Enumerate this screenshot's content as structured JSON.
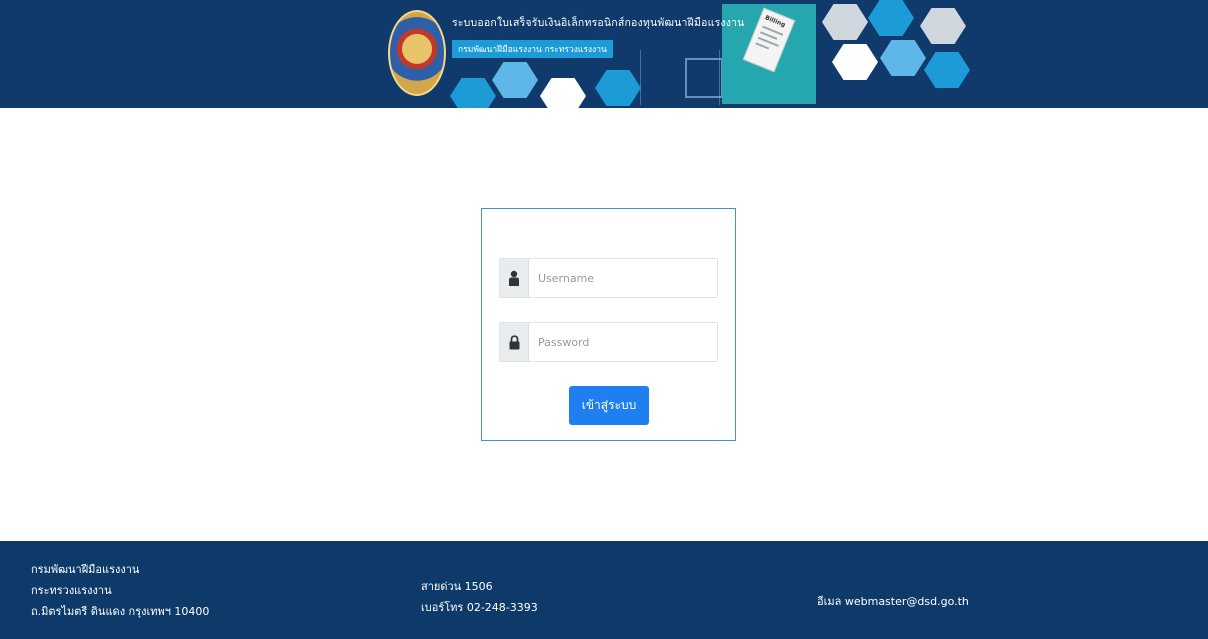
{
  "header": {
    "title": "ระบบออกใบเสร็จรับเงินอิเล็กทรอนิกส์กองทุนพัฒนาฝีมือแรงงาน",
    "subtitle": "กรมพัฒนาฝีมือแรงงาน กระทรวงแรงงาน",
    "receipt_text": "Billing",
    "colors": {
      "bar": "#0f3a6b",
      "accent": "#1d9bd6"
    }
  },
  "login": {
    "username_placeholder": "Username",
    "password_placeholder": "Password",
    "submit_label": "เข้าสู่ระบบ",
    "username_icon": "user-icon",
    "password_icon": "lock-icon",
    "button_color": "#1f7ff0"
  },
  "footer": {
    "org": [
      "กรมพัฒนาฝีมือแรงงาน",
      "กระทรวงแรงงาน",
      "ถ.มิตรไมตรี ดินแดง กรุงเทพฯ 10400"
    ],
    "contact": [
      "สายด่วน 1506",
      "เบอร์โทร 02-248-3393"
    ],
    "email": "อีเมล webmaster@dsd.go.th"
  }
}
